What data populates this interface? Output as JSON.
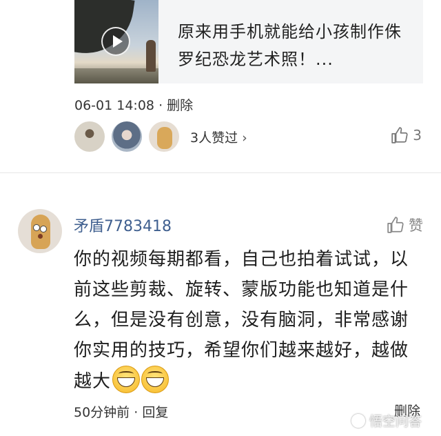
{
  "video": {
    "title": "原来用手机就能给小孩制作侏罗纪恐龙艺术照！...",
    "thumbnail_icon": "play-icon"
  },
  "post": {
    "time": "06-01 14:08",
    "separator": "·",
    "delete_label": "删除",
    "likers_text": "3人赞过",
    "likers_chevron": "›",
    "like_count": "3"
  },
  "comment": {
    "username": "矛盾7783418",
    "like_label": "赞",
    "text": "你的视频每期都看，自己也拍着试试，以前这些剪裁、旋转、蒙版功能也知道是什么，但是没有创意，没有脑洞，非常感谢你实用的技巧，希望你们越来越好，越做越大",
    "emojis": [
      "grinning-face-icon",
      "grinning-face-icon"
    ],
    "time": "50分钟前",
    "separator": "·",
    "reply_label": "回复",
    "delete_label": "删除"
  },
  "watermark": {
    "text": "悟空问答"
  },
  "colors": {
    "username": "#3f5f8f",
    "text": "#1e1e1e",
    "meta": "#333333",
    "card_bg": "#f4f5f6"
  }
}
